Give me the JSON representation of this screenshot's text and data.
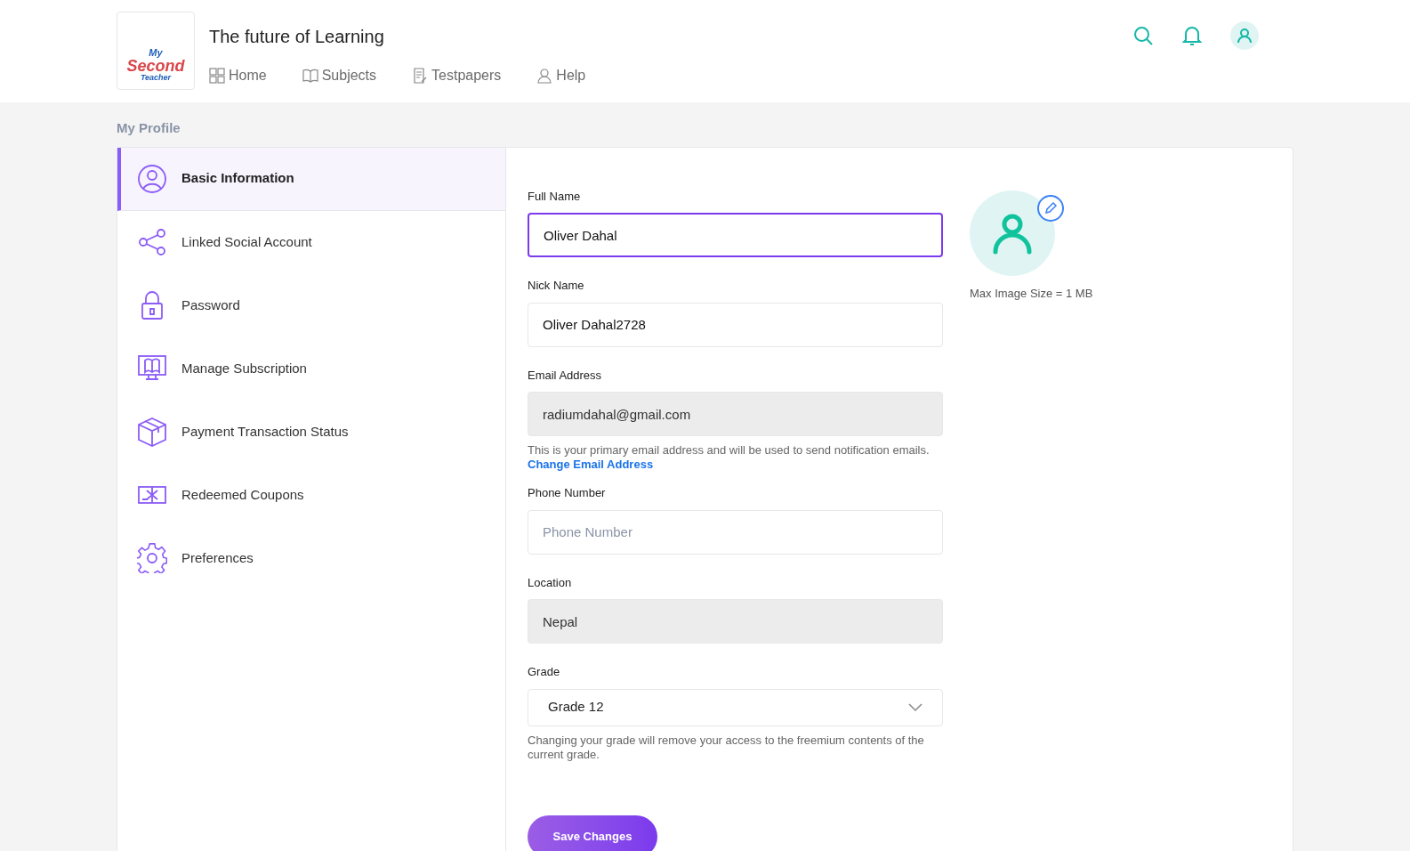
{
  "header": {
    "logo": {
      "line_1": "My",
      "line_2": "Second",
      "line_3": "Teacher"
    },
    "tagline": "The future of Learning",
    "nav": [
      {
        "label": "Home"
      },
      {
        "label": "Subjects"
      },
      {
        "label": "Testpapers"
      },
      {
        "label": "Help"
      }
    ]
  },
  "page_title": "My Profile",
  "sidebar": {
    "items": [
      {
        "label": "Basic Information",
        "selected": true
      },
      {
        "label": "Linked Social Account",
        "selected": false
      },
      {
        "label": "Password",
        "selected": false
      },
      {
        "label": "Manage Subscription",
        "selected": false
      },
      {
        "label": "Payment Transaction Status",
        "selected": false
      },
      {
        "label": "Redeemed Coupons",
        "selected": false
      },
      {
        "label": "Preferences",
        "selected": false
      }
    ]
  },
  "form": {
    "fields": [
      {
        "kind": "text",
        "label": "Full Name",
        "value": "Oliver Dahal",
        "focused": true,
        "disabled": false
      },
      {
        "kind": "text",
        "label": "Nick Name",
        "value": "Oliver Dahal2728",
        "focused": false,
        "disabled": false
      },
      {
        "kind": "text",
        "label": "Email Address",
        "value": "radiumdahal@gmail.com",
        "focused": false,
        "disabled": true,
        "help": "This is your primary email address and will be used to send notification emails.",
        "help_link": "Change Email Address"
      },
      {
        "kind": "text",
        "label": "Phone Number",
        "placeholder": "Phone Number",
        "focused": false,
        "disabled": false
      },
      {
        "kind": "text",
        "label": "Location",
        "value": "Nepal",
        "focused": false,
        "disabled": true
      },
      {
        "kind": "select",
        "label": "Grade",
        "value": "Grade 12",
        "help": "Changing your grade will remove your access to the freemium contents of the current grade."
      }
    ],
    "save_button": "Save Changes"
  },
  "avatar": {
    "note": "Max Image Size = 1 MB"
  }
}
